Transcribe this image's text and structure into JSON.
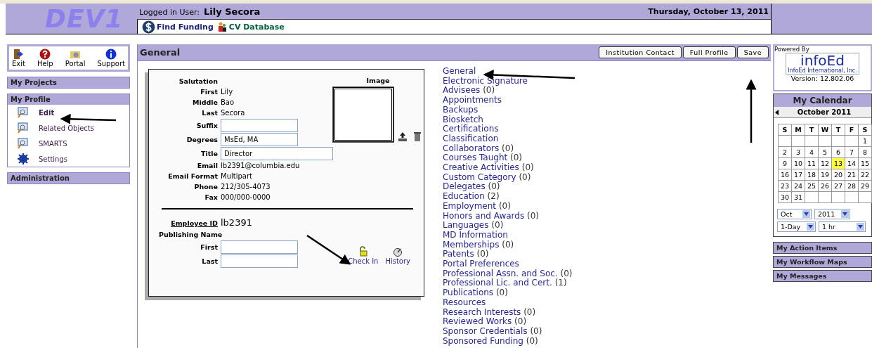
{
  "header": {
    "env_label": "DEV1",
    "user_label": "Logged in User:",
    "user_name": "Lily Secora",
    "date": "Thursday, October 13, 2011",
    "nav": [
      {
        "label": "Find Funding",
        "kind": "dollar"
      },
      {
        "label": "CV Database",
        "kind": "people"
      }
    ]
  },
  "toolbar": [
    {
      "label": "Exit",
      "kind": "exit"
    },
    {
      "label": "Help",
      "kind": "help"
    },
    {
      "label": "Portal",
      "kind": "portal"
    },
    {
      "label": "Support",
      "kind": "info"
    }
  ],
  "sidebar": [
    {
      "title": "My Projects"
    },
    {
      "title": "My Profile",
      "items": [
        {
          "label": "Edit",
          "kind": "monitor",
          "selected": true
        },
        {
          "label": "Related Objects",
          "kind": "monitor",
          "selected": false
        },
        {
          "label": "SMARTS",
          "kind": "monitor",
          "selected": false
        },
        {
          "label": "Settings",
          "kind": "gear",
          "selected": false
        }
      ]
    },
    {
      "title": "Administration"
    }
  ],
  "main": {
    "title": "General",
    "buttons": [
      "Institution Contact",
      "Full Profile",
      "Save"
    ],
    "fields": [
      {
        "label": "Salutation",
        "kind": "text"
      },
      {
        "label": "First",
        "kind": "text",
        "value": "Lily"
      },
      {
        "label": "Middle",
        "kind": "text",
        "value": "Bao"
      },
      {
        "label": "Last",
        "kind": "text",
        "value": "Secora"
      },
      {
        "label": "Suffix",
        "kind": "input"
      },
      {
        "label": "Degrees",
        "kind": "input",
        "value": "MsEd, MA"
      },
      {
        "label": "Title",
        "kind": "wide-input",
        "value": "Director"
      },
      {
        "label": "Email",
        "kind": "text",
        "value": "lb2391@columbia.edu"
      },
      {
        "label": "Email Format",
        "kind": "text",
        "value": "Multipart"
      },
      {
        "label": "Phone",
        "kind": "text",
        "value": "212/305-4073"
      },
      {
        "label": "Fax",
        "kind": "text",
        "value": "000/000-0000"
      }
    ],
    "image_label": "Image",
    "employee_id": {
      "label": "Employee ID",
      "value": "lb2391"
    },
    "publishing_name": {
      "label": "Publishing Name",
      "fields": [
        {
          "label": "First"
        },
        {
          "label": "Last"
        }
      ]
    },
    "actions": [
      {
        "label": "Check In",
        "kind": "lock"
      },
      {
        "label": "History",
        "kind": "history"
      }
    ],
    "links": [
      {
        "label": "General"
      },
      {
        "label": "Electronic Signature"
      },
      {
        "label": "Advisees",
        "count": "(0)"
      },
      {
        "label": "Appointments"
      },
      {
        "label": "Backups"
      },
      {
        "label": "Biosketch"
      },
      {
        "label": "Certifications"
      },
      {
        "label": "Classification"
      },
      {
        "label": "Collaborators",
        "count": "(0)"
      },
      {
        "label": "Courses Taught",
        "count": "(0)"
      },
      {
        "label": "Creative Activities",
        "count": "(0)"
      },
      {
        "label": "Custom Category",
        "count": "(0)"
      },
      {
        "label": "Delegates",
        "count": "(0)"
      },
      {
        "label": "Education",
        "count": "(2)"
      },
      {
        "label": "Employment",
        "count": "(0)"
      },
      {
        "label": "Honors and Awards",
        "count": "(0)"
      },
      {
        "label": "Languages",
        "count": "(0)"
      },
      {
        "label": "MD Information"
      },
      {
        "label": "Memberships",
        "count": "(0)"
      },
      {
        "label": "Patents",
        "count": "(0)"
      },
      {
        "label": "Portal Preferences"
      },
      {
        "label": "Professional Assn. and Soc.",
        "count": "(0)"
      },
      {
        "label": "Professional Lic. and Cert.",
        "count": "(1)"
      },
      {
        "label": "Publications",
        "count": "(0)"
      },
      {
        "label": "Resources"
      },
      {
        "label": "Research Interests",
        "count": "(0)"
      },
      {
        "label": "Reviewed Works",
        "count": "(0)"
      },
      {
        "label": "Sponsor Credentials",
        "count": "(0)"
      },
      {
        "label": "Sponsored Funding",
        "count": "(0)"
      }
    ]
  },
  "right": {
    "powered_by": "Powered By",
    "logo": "infoEd",
    "logo_sub": "InfoEd International, Inc.",
    "version": "Version: 12.802.06",
    "calendar": {
      "title": "My Calendar",
      "month": "October 2011",
      "weekdays": [
        "S",
        "M",
        "T",
        "W",
        "T",
        "F",
        "S"
      ],
      "weeks": [
        [
          {
            "kind": "blank"
          },
          {
            "kind": "blank"
          },
          {
            "kind": "blank"
          },
          {
            "kind": "blank"
          },
          {
            "kind": "blank"
          },
          {
            "kind": "blank"
          },
          {
            "kind": "day",
            "day": "1",
            "selected": false
          }
        ],
        [
          {
            "kind": "day",
            "day": "2",
            "selected": false
          },
          {
            "kind": "day",
            "day": "3",
            "selected": false
          },
          {
            "kind": "day",
            "day": "4",
            "selected": false
          },
          {
            "kind": "day",
            "day": "5",
            "selected": false
          },
          {
            "kind": "day",
            "day": "6",
            "selected": false
          },
          {
            "kind": "day",
            "day": "7",
            "selected": false
          },
          {
            "kind": "day",
            "day": "8",
            "selected": false
          }
        ],
        [
          {
            "kind": "day",
            "day": "9",
            "selected": false
          },
          {
            "kind": "day",
            "day": "10",
            "selected": false
          },
          {
            "kind": "day",
            "day": "11",
            "selected": false
          },
          {
            "kind": "day",
            "day": "12",
            "selected": false
          },
          {
            "kind": "day",
            "day": "13",
            "selected": true
          },
          {
            "kind": "day",
            "day": "14",
            "selected": false
          },
          {
            "kind": "day",
            "day": "15",
            "selected": false
          }
        ],
        [
          {
            "kind": "day",
            "day": "16",
            "selected": false
          },
          {
            "kind": "day",
            "day": "17",
            "selected": false
          },
          {
            "kind": "day",
            "day": "18",
            "selected": false
          },
          {
            "kind": "day",
            "day": "19",
            "selected": false
          },
          {
            "kind": "day",
            "day": "20",
            "selected": false
          },
          {
            "kind": "day",
            "day": "21",
            "selected": false
          },
          {
            "kind": "day",
            "day": "22",
            "selected": false
          }
        ],
        [
          {
            "kind": "day",
            "day": "23",
            "selected": false
          },
          {
            "kind": "day",
            "day": "24",
            "selected": false
          },
          {
            "kind": "day",
            "day": "25",
            "selected": false
          },
          {
            "kind": "day",
            "day": "26",
            "selected": false
          },
          {
            "kind": "day",
            "day": "27",
            "selected": false
          },
          {
            "kind": "day",
            "day": "28",
            "selected": false
          },
          {
            "kind": "day",
            "day": "29",
            "selected": false
          }
        ],
        [
          {
            "kind": "day",
            "day": "30",
            "selected": false
          },
          {
            "kind": "day",
            "day": "31",
            "selected": false
          },
          {
            "kind": "blank"
          },
          {
            "kind": "blank"
          },
          {
            "kind": "blank"
          },
          {
            "kind": "blank"
          },
          {
            "kind": "blank"
          }
        ]
      ],
      "selects": [
        [
          "Oct",
          "2011"
        ],
        [
          "1-Day",
          "1 hr"
        ]
      ]
    },
    "panels": [
      "My Action Items",
      "My Workflow Maps",
      "My Messages"
    ]
  }
}
